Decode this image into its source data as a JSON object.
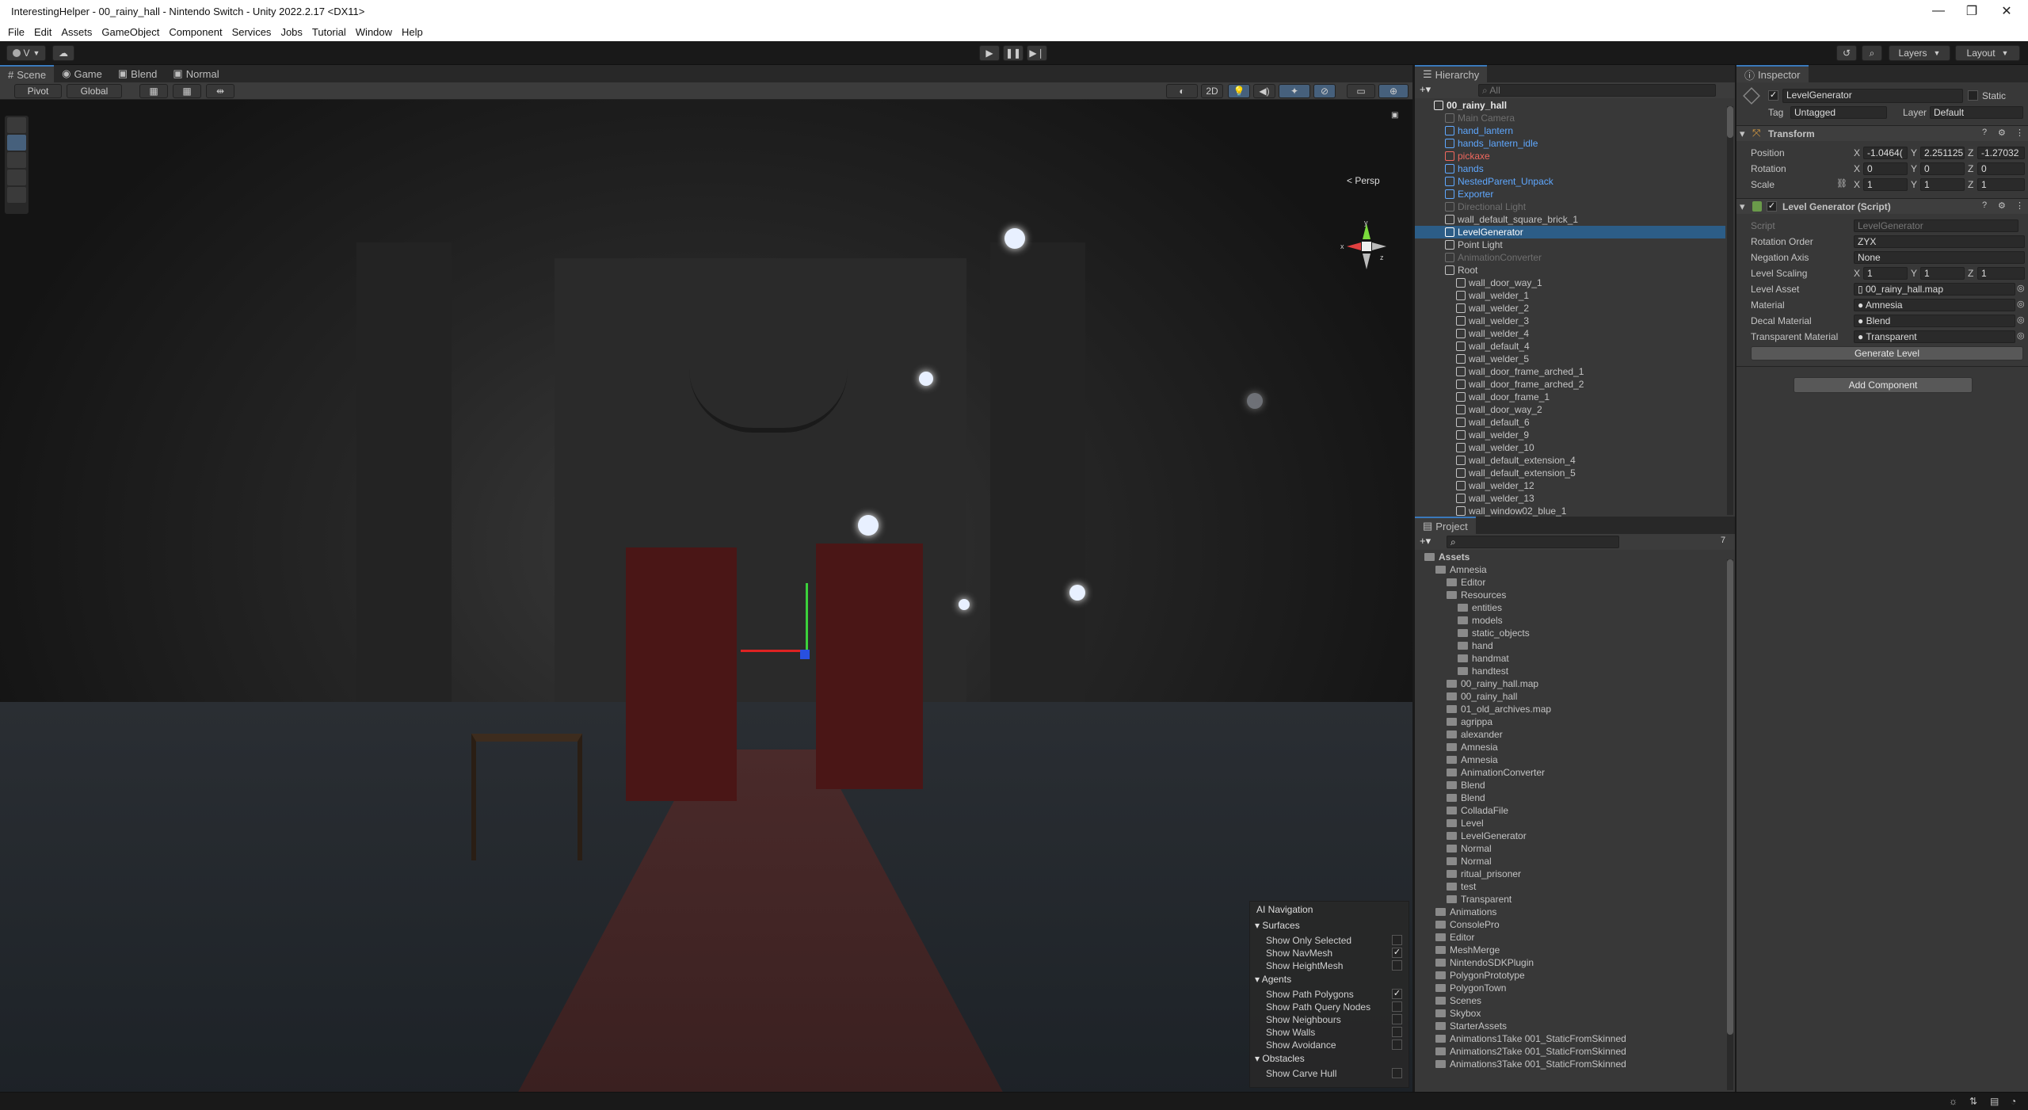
{
  "window": {
    "title": "InterestingHelper - 00_rainy_hall - Nintendo Switch - Unity 2022.2.17 <DX11>",
    "controls": [
      "—",
      "❐",
      "✕"
    ]
  },
  "menu": [
    "File",
    "Edit",
    "Assets",
    "GameObject",
    "Component",
    "Services",
    "Jobs",
    "Tutorial",
    "Window",
    "Help"
  ],
  "toolbar": {
    "account_label": "V",
    "layers_label": "Layers",
    "layout_label": "Layout"
  },
  "scene_tabs": [
    "Scene",
    "Game",
    "Blend",
    "Normal"
  ],
  "scene_toolbar": {
    "pivot": "Pivot",
    "global": "Global",
    "mode_2d": "2D"
  },
  "scene": {
    "persp_label": "< Persp",
    "gizmo_axes": [
      "y",
      "x",
      "z"
    ]
  },
  "ai_navigation": {
    "title": "AI Navigation",
    "sections": [
      {
        "name": "Surfaces",
        "items": [
          {
            "label": "Show Only Selected",
            "checked": false
          },
          {
            "label": "Show NavMesh",
            "checked": true
          },
          {
            "label": "Show HeightMesh",
            "checked": false
          }
        ]
      },
      {
        "name": "Agents",
        "items": [
          {
            "label": "Show Path Polygons",
            "checked": true
          },
          {
            "label": "Show Path Query Nodes",
            "checked": false
          },
          {
            "label": "Show Neighbours",
            "checked": false
          },
          {
            "label": "Show Walls",
            "checked": false
          },
          {
            "label": "Show Avoidance",
            "checked": false
          }
        ]
      },
      {
        "name": "Obstacles",
        "items": [
          {
            "label": "Show Carve Hull",
            "checked": false
          }
        ]
      }
    ]
  },
  "hierarchy": {
    "tab": "Hierarchy",
    "search_placeholder": "All",
    "rows": [
      {
        "label": "00_rainy_hall",
        "indent": 0,
        "color": "#e6e6e6",
        "bold": true
      },
      {
        "label": "Main Camera",
        "indent": 1,
        "color": "#6f6f6f"
      },
      {
        "label": "hand_lantern",
        "indent": 1,
        "color": "#5fa8ff"
      },
      {
        "label": "hands_lantern_idle",
        "indent": 1,
        "color": "#5fa8ff"
      },
      {
        "label": "pickaxe",
        "indent": 1,
        "color": "#f0685e"
      },
      {
        "label": "hands",
        "indent": 1,
        "color": "#5fa8ff"
      },
      {
        "label": "NestedParent_Unpack",
        "indent": 1,
        "color": "#5fa8ff"
      },
      {
        "label": "Exporter",
        "indent": 1,
        "color": "#5fa8ff"
      },
      {
        "label": "Directional Light",
        "indent": 1,
        "color": "#6f6f6f"
      },
      {
        "label": "wall_default_square_brick_1",
        "indent": 1,
        "color": "#c4c4c4"
      },
      {
        "label": "LevelGenerator",
        "indent": 1,
        "color": "#ffffff",
        "selected": true
      },
      {
        "label": "Point Light",
        "indent": 1,
        "color": "#c4c4c4"
      },
      {
        "label": "AnimationConverter",
        "indent": 1,
        "color": "#6f6f6f"
      },
      {
        "label": "Root",
        "indent": 1,
        "color": "#c4c4c4"
      },
      {
        "label": "wall_door_way_1",
        "indent": 2,
        "color": "#c4c4c4"
      },
      {
        "label": "wall_welder_1",
        "indent": 2,
        "color": "#c4c4c4"
      },
      {
        "label": "wall_welder_2",
        "indent": 2,
        "color": "#c4c4c4"
      },
      {
        "label": "wall_welder_3",
        "indent": 2,
        "color": "#c4c4c4"
      },
      {
        "label": "wall_welder_4",
        "indent": 2,
        "color": "#c4c4c4"
      },
      {
        "label": "wall_default_4",
        "indent": 2,
        "color": "#c4c4c4"
      },
      {
        "label": "wall_welder_5",
        "indent": 2,
        "color": "#c4c4c4"
      },
      {
        "label": "wall_door_frame_arched_1",
        "indent": 2,
        "color": "#c4c4c4"
      },
      {
        "label": "wall_door_frame_arched_2",
        "indent": 2,
        "color": "#c4c4c4"
      },
      {
        "label": "wall_door_frame_1",
        "indent": 2,
        "color": "#c4c4c4"
      },
      {
        "label": "wall_door_way_2",
        "indent": 2,
        "color": "#c4c4c4"
      },
      {
        "label": "wall_default_6",
        "indent": 2,
        "color": "#c4c4c4"
      },
      {
        "label": "wall_welder_9",
        "indent": 2,
        "color": "#c4c4c4"
      },
      {
        "label": "wall_welder_10",
        "indent": 2,
        "color": "#c4c4c4"
      },
      {
        "label": "wall_default_extension_4",
        "indent": 2,
        "color": "#c4c4c4"
      },
      {
        "label": "wall_default_extension_5",
        "indent": 2,
        "color": "#c4c4c4"
      },
      {
        "label": "wall_welder_12",
        "indent": 2,
        "color": "#c4c4c4"
      },
      {
        "label": "wall_welder_13",
        "indent": 2,
        "color": "#c4c4c4"
      },
      {
        "label": "wall_window02_blue_1",
        "indent": 2,
        "color": "#c4c4c4"
      }
    ]
  },
  "project": {
    "tab": "Project",
    "hidden_count": "7",
    "rows": [
      {
        "label": "Assets",
        "indent": 0,
        "bold": true
      },
      {
        "label": "Amnesia",
        "indent": 1
      },
      {
        "label": "Editor",
        "indent": 2
      },
      {
        "label": "Resources",
        "indent": 2
      },
      {
        "label": "entities",
        "indent": 3
      },
      {
        "label": "models",
        "indent": 3
      },
      {
        "label": "static_objects",
        "indent": 3
      },
      {
        "label": "hand",
        "indent": 3
      },
      {
        "label": "handmat",
        "indent": 3
      },
      {
        "label": "handtest",
        "indent": 3
      },
      {
        "label": "00_rainy_hall.map",
        "indent": 2
      },
      {
        "label": "00_rainy_hall",
        "indent": 2
      },
      {
        "label": "01_old_archives.map",
        "indent": 2
      },
      {
        "label": "agrippa",
        "indent": 2
      },
      {
        "label": "alexander",
        "indent": 2
      },
      {
        "label": "Amnesia",
        "indent": 2
      },
      {
        "label": "Amnesia",
        "indent": 2
      },
      {
        "label": "AnimationConverter",
        "indent": 2
      },
      {
        "label": "Blend",
        "indent": 2
      },
      {
        "label": "Blend",
        "indent": 2
      },
      {
        "label": "ColladaFile",
        "indent": 2
      },
      {
        "label": "Level",
        "indent": 2
      },
      {
        "label": "LevelGenerator",
        "indent": 2
      },
      {
        "label": "Normal",
        "indent": 2
      },
      {
        "label": "Normal",
        "indent": 2
      },
      {
        "label": "ritual_prisoner",
        "indent": 2
      },
      {
        "label": "test",
        "indent": 2
      },
      {
        "label": "Transparent",
        "indent": 2
      },
      {
        "label": "Animations",
        "indent": 1
      },
      {
        "label": "ConsolePro",
        "indent": 1
      },
      {
        "label": "Editor",
        "indent": 1
      },
      {
        "label": "MeshMerge",
        "indent": 1
      },
      {
        "label": "NintendoSDKPlugin",
        "indent": 1
      },
      {
        "label": "PolygonPrototype",
        "indent": 1
      },
      {
        "label": "PolygonTown",
        "indent": 1
      },
      {
        "label": "Scenes",
        "indent": 1
      },
      {
        "label": "Skybox",
        "indent": 1
      },
      {
        "label": "StarterAssets",
        "indent": 1
      },
      {
        "label": "Animations1Take 001_StaticFromSkinned",
        "indent": 1
      },
      {
        "label": "Animations2Take 001_StaticFromSkinned",
        "indent": 1
      },
      {
        "label": "Animations3Take 001_StaticFromSkinned",
        "indent": 1
      }
    ]
  },
  "inspector": {
    "tab": "Inspector",
    "object_name": "LevelGenerator",
    "static_label": "Static",
    "tag_label": "Tag",
    "tag_value": "Untagged",
    "layer_label": "Layer",
    "layer_value": "Default",
    "transform": {
      "title": "Transform",
      "position_label": "Position",
      "rotation_label": "Rotation",
      "scale_label": "Scale",
      "position": [
        "-1.0464(",
        "2.251125",
        "-1.27032"
      ],
      "rotation": [
        "0",
        "0",
        "0"
      ],
      "scale": [
        "1",
        "1",
        "1"
      ]
    },
    "component": {
      "title": "Level Generator (Script)",
      "script_label": "Script",
      "script_value": "LevelGenerator",
      "rotation_order_label": "Rotation Order",
      "rotation_order_value": "ZYX",
      "negation_axis_label": "Negation Axis",
      "negation_axis_value": "None",
      "level_scaling_label": "Level Scaling",
      "level_scaling": [
        "1",
        "1",
        "1"
      ],
      "level_asset_label": "Level Asset",
      "level_asset_value": "00_rainy_hall.map",
      "material_label": "Material",
      "material_value": "Amnesia",
      "decal_material_label": "Decal Material",
      "decal_material_value": "Blend",
      "transparent_material_label": "Transparent Material",
      "transparent_material_value": "Transparent",
      "generate_button": "Generate Level"
    },
    "add_component_button": "Add Component"
  },
  "colors": {
    "accent": "#3a79bb",
    "selection": "#2c5d87",
    "prefab_blue": "#5fa8ff",
    "missing_red": "#f0685e"
  }
}
